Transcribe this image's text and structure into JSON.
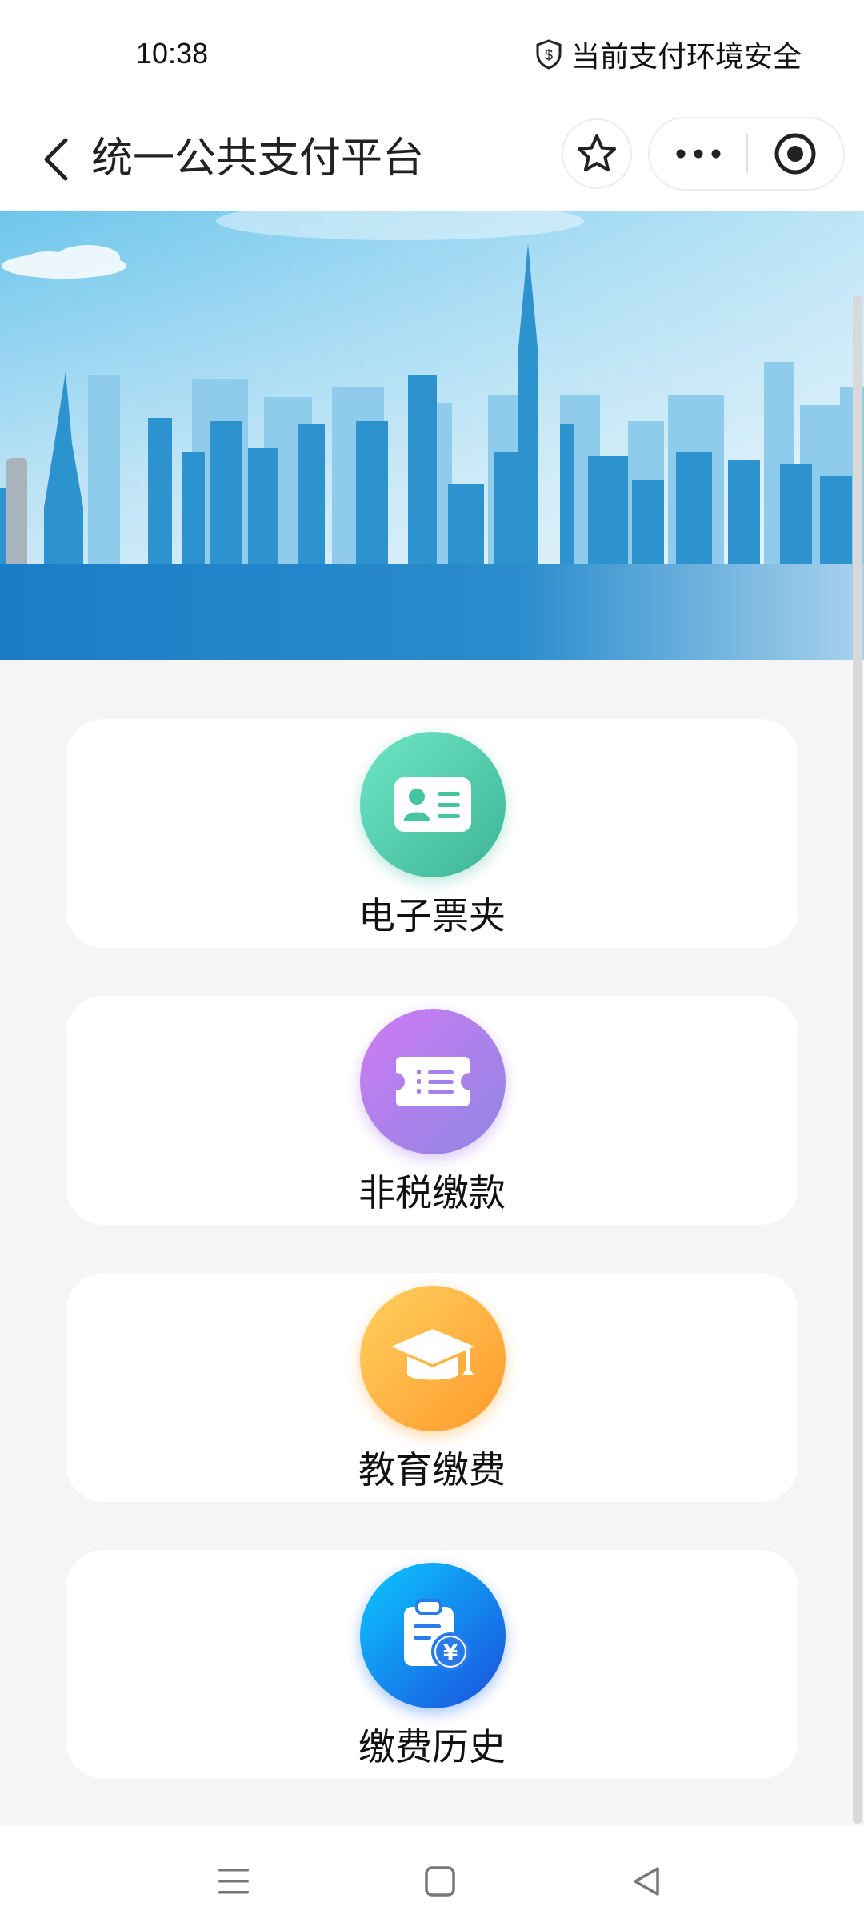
{
  "status_bar": {
    "time": "10:38",
    "security_text": "当前支付环境安全",
    "security_icon": "shield-dollar-icon"
  },
  "nav": {
    "title": "统一公共支付平台",
    "back_icon": "chevron-left-icon",
    "favorite_icon": "star-icon",
    "more_icon": "ellipsis-icon",
    "close_icon": "target-circle-icon"
  },
  "services": [
    {
      "label": "电子票夹",
      "icon": "id-card-icon",
      "colors": [
        "#6fe0c2",
        "#3fb99a"
      ]
    },
    {
      "label": "非税缴款",
      "icon": "ticket-icon",
      "colors": [
        "#c57af3",
        "#8a7fe0"
      ]
    },
    {
      "label": "教育缴费",
      "icon": "graduation-cap-icon",
      "colors": [
        "#ffcb5c",
        "#ff9f2e"
      ]
    },
    {
      "label": "缴费历史",
      "icon": "bill-history-icon",
      "colors": [
        "#14c2ff",
        "#1a55e0"
      ]
    }
  ],
  "system_nav": {
    "menu_icon": "menu-icon",
    "home_icon": "square-icon",
    "back_icon": "triangle-back-icon"
  }
}
